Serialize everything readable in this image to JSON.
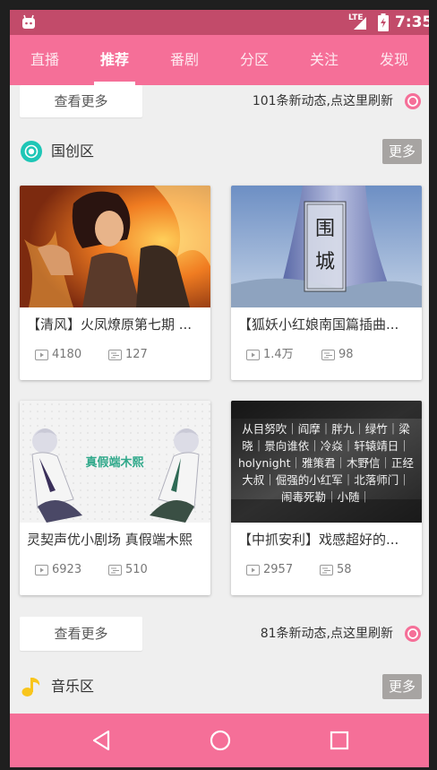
{
  "status_bar": {
    "network": "LTE",
    "time": "7:35"
  },
  "tabs": [
    {
      "label": "直播"
    },
    {
      "label": "推荐"
    },
    {
      "label": "番剧"
    },
    {
      "label": "分区"
    },
    {
      "label": "关注"
    },
    {
      "label": "发现"
    }
  ],
  "active_tab": "推荐",
  "refresh_top": {
    "more_label": "查看更多",
    "text": "101条新动态,点这里刷新"
  },
  "section_guochuang": {
    "title": "国创区",
    "more_label": "更多"
  },
  "cards": [
    {
      "title": "【清风】火凤燎原第七期 ...",
      "views": "4180",
      "danmaku": "127"
    },
    {
      "title": "【狐妖小红娘南国篇插曲...",
      "views": "1.4万",
      "danmaku": "98",
      "image_text": "围城"
    },
    {
      "title": "灵契声优小剧场 真假端木熙",
      "views": "6923",
      "danmaku": "510",
      "image_text": "真假端木熙"
    },
    {
      "title": "【中抓安利】戏感超好的...",
      "views": "2957",
      "danmaku": "58",
      "image_lines": [
        "从目努吹｜阎摩｜胖九｜绿竹｜梁",
        "晓｜景向谁依｜冷焱｜轩辕靖日｜",
        "holynight｜雅策君｜木野信｜正经",
        "大叔｜倔强的小红军｜北落师门｜",
        "闹毒死勒｜小随｜"
      ]
    }
  ],
  "refresh_bottom": {
    "more_label": "查看更多",
    "text": "81条新动态,点这里刷新"
  },
  "section_music": {
    "title": "音乐区",
    "more_label": "更多"
  },
  "colors": {
    "accent": "#f56f98",
    "status_bar": "#c24b6a",
    "badge_teal": "#1ec6b6",
    "music_yellow": "#f8c51c",
    "more_grey": "#a7a4a2"
  }
}
